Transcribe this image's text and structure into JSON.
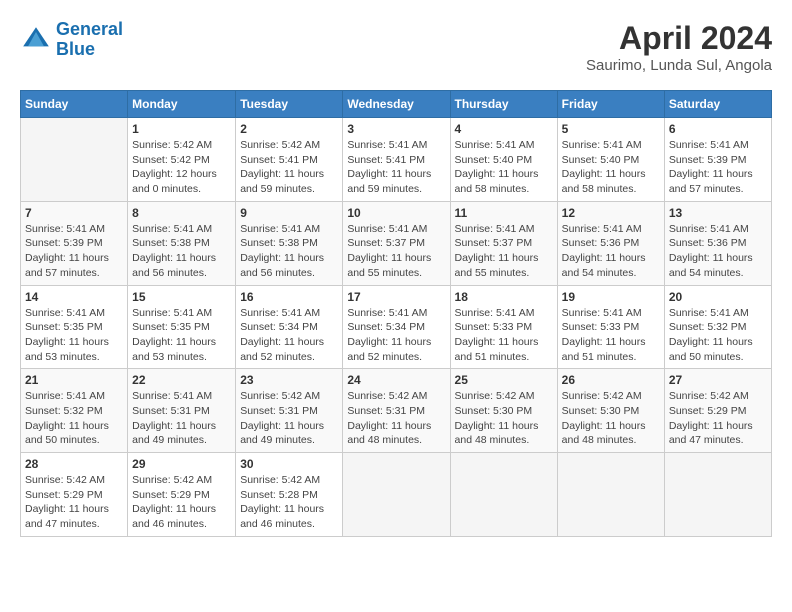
{
  "header": {
    "logo_line1": "General",
    "logo_line2": "Blue",
    "title": "April 2024",
    "subtitle": "Saurimo, Lunda Sul, Angola"
  },
  "days_of_week": [
    "Sunday",
    "Monday",
    "Tuesday",
    "Wednesday",
    "Thursday",
    "Friday",
    "Saturday"
  ],
  "weeks": [
    [
      {
        "day": "",
        "info": ""
      },
      {
        "day": "1",
        "info": "Sunrise: 5:42 AM\nSunset: 5:42 PM\nDaylight: 12 hours\nand 0 minutes."
      },
      {
        "day": "2",
        "info": "Sunrise: 5:42 AM\nSunset: 5:41 PM\nDaylight: 11 hours\nand 59 minutes."
      },
      {
        "day": "3",
        "info": "Sunrise: 5:41 AM\nSunset: 5:41 PM\nDaylight: 11 hours\nand 59 minutes."
      },
      {
        "day": "4",
        "info": "Sunrise: 5:41 AM\nSunset: 5:40 PM\nDaylight: 11 hours\nand 58 minutes."
      },
      {
        "day": "5",
        "info": "Sunrise: 5:41 AM\nSunset: 5:40 PM\nDaylight: 11 hours\nand 58 minutes."
      },
      {
        "day": "6",
        "info": "Sunrise: 5:41 AM\nSunset: 5:39 PM\nDaylight: 11 hours\nand 57 minutes."
      }
    ],
    [
      {
        "day": "7",
        "info": "Sunrise: 5:41 AM\nSunset: 5:39 PM\nDaylight: 11 hours\nand 57 minutes."
      },
      {
        "day": "8",
        "info": "Sunrise: 5:41 AM\nSunset: 5:38 PM\nDaylight: 11 hours\nand 56 minutes."
      },
      {
        "day": "9",
        "info": "Sunrise: 5:41 AM\nSunset: 5:38 PM\nDaylight: 11 hours\nand 56 minutes."
      },
      {
        "day": "10",
        "info": "Sunrise: 5:41 AM\nSunset: 5:37 PM\nDaylight: 11 hours\nand 55 minutes."
      },
      {
        "day": "11",
        "info": "Sunrise: 5:41 AM\nSunset: 5:37 PM\nDaylight: 11 hours\nand 55 minutes."
      },
      {
        "day": "12",
        "info": "Sunrise: 5:41 AM\nSunset: 5:36 PM\nDaylight: 11 hours\nand 54 minutes."
      },
      {
        "day": "13",
        "info": "Sunrise: 5:41 AM\nSunset: 5:36 PM\nDaylight: 11 hours\nand 54 minutes."
      }
    ],
    [
      {
        "day": "14",
        "info": "Sunrise: 5:41 AM\nSunset: 5:35 PM\nDaylight: 11 hours\nand 53 minutes."
      },
      {
        "day": "15",
        "info": "Sunrise: 5:41 AM\nSunset: 5:35 PM\nDaylight: 11 hours\nand 53 minutes."
      },
      {
        "day": "16",
        "info": "Sunrise: 5:41 AM\nSunset: 5:34 PM\nDaylight: 11 hours\nand 52 minutes."
      },
      {
        "day": "17",
        "info": "Sunrise: 5:41 AM\nSunset: 5:34 PM\nDaylight: 11 hours\nand 52 minutes."
      },
      {
        "day": "18",
        "info": "Sunrise: 5:41 AM\nSunset: 5:33 PM\nDaylight: 11 hours\nand 51 minutes."
      },
      {
        "day": "19",
        "info": "Sunrise: 5:41 AM\nSunset: 5:33 PM\nDaylight: 11 hours\nand 51 minutes."
      },
      {
        "day": "20",
        "info": "Sunrise: 5:41 AM\nSunset: 5:32 PM\nDaylight: 11 hours\nand 50 minutes."
      }
    ],
    [
      {
        "day": "21",
        "info": "Sunrise: 5:41 AM\nSunset: 5:32 PM\nDaylight: 11 hours\nand 50 minutes."
      },
      {
        "day": "22",
        "info": "Sunrise: 5:41 AM\nSunset: 5:31 PM\nDaylight: 11 hours\nand 49 minutes."
      },
      {
        "day": "23",
        "info": "Sunrise: 5:42 AM\nSunset: 5:31 PM\nDaylight: 11 hours\nand 49 minutes."
      },
      {
        "day": "24",
        "info": "Sunrise: 5:42 AM\nSunset: 5:31 PM\nDaylight: 11 hours\nand 48 minutes."
      },
      {
        "day": "25",
        "info": "Sunrise: 5:42 AM\nSunset: 5:30 PM\nDaylight: 11 hours\nand 48 minutes."
      },
      {
        "day": "26",
        "info": "Sunrise: 5:42 AM\nSunset: 5:30 PM\nDaylight: 11 hours\nand 48 minutes."
      },
      {
        "day": "27",
        "info": "Sunrise: 5:42 AM\nSunset: 5:29 PM\nDaylight: 11 hours\nand 47 minutes."
      }
    ],
    [
      {
        "day": "28",
        "info": "Sunrise: 5:42 AM\nSunset: 5:29 PM\nDaylight: 11 hours\nand 47 minutes."
      },
      {
        "day": "29",
        "info": "Sunrise: 5:42 AM\nSunset: 5:29 PM\nDaylight: 11 hours\nand 46 minutes."
      },
      {
        "day": "30",
        "info": "Sunrise: 5:42 AM\nSunset: 5:28 PM\nDaylight: 11 hours\nand 46 minutes."
      },
      {
        "day": "",
        "info": ""
      },
      {
        "day": "",
        "info": ""
      },
      {
        "day": "",
        "info": ""
      },
      {
        "day": "",
        "info": ""
      }
    ]
  ]
}
